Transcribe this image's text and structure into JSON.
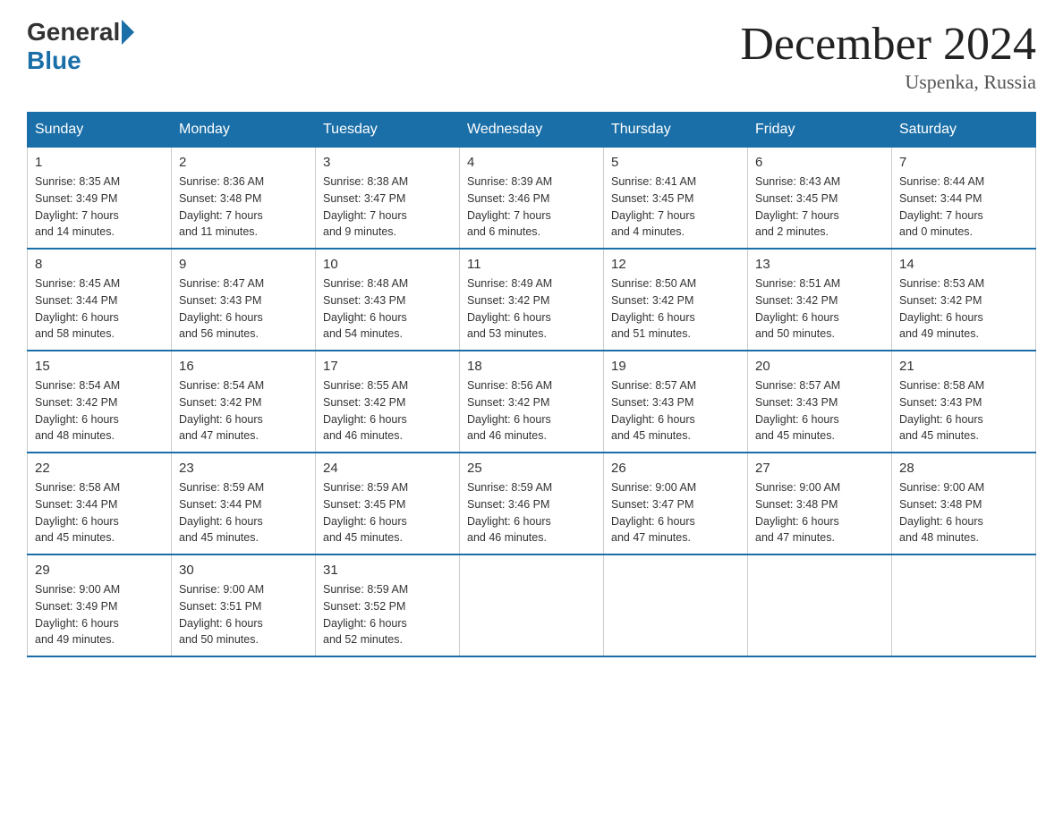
{
  "logo": {
    "general": "General",
    "blue": "Blue"
  },
  "header": {
    "title": "December 2024",
    "subtitle": "Uspenka, Russia"
  },
  "days_of_week": [
    "Sunday",
    "Monday",
    "Tuesday",
    "Wednesday",
    "Thursday",
    "Friday",
    "Saturday"
  ],
  "weeks": [
    [
      {
        "day": "1",
        "info": "Sunrise: 8:35 AM\nSunset: 3:49 PM\nDaylight: 7 hours\nand 14 minutes."
      },
      {
        "day": "2",
        "info": "Sunrise: 8:36 AM\nSunset: 3:48 PM\nDaylight: 7 hours\nand 11 minutes."
      },
      {
        "day": "3",
        "info": "Sunrise: 8:38 AM\nSunset: 3:47 PM\nDaylight: 7 hours\nand 9 minutes."
      },
      {
        "day": "4",
        "info": "Sunrise: 8:39 AM\nSunset: 3:46 PM\nDaylight: 7 hours\nand 6 minutes."
      },
      {
        "day": "5",
        "info": "Sunrise: 8:41 AM\nSunset: 3:45 PM\nDaylight: 7 hours\nand 4 minutes."
      },
      {
        "day": "6",
        "info": "Sunrise: 8:43 AM\nSunset: 3:45 PM\nDaylight: 7 hours\nand 2 minutes."
      },
      {
        "day": "7",
        "info": "Sunrise: 8:44 AM\nSunset: 3:44 PM\nDaylight: 7 hours\nand 0 minutes."
      }
    ],
    [
      {
        "day": "8",
        "info": "Sunrise: 8:45 AM\nSunset: 3:44 PM\nDaylight: 6 hours\nand 58 minutes."
      },
      {
        "day": "9",
        "info": "Sunrise: 8:47 AM\nSunset: 3:43 PM\nDaylight: 6 hours\nand 56 minutes."
      },
      {
        "day": "10",
        "info": "Sunrise: 8:48 AM\nSunset: 3:43 PM\nDaylight: 6 hours\nand 54 minutes."
      },
      {
        "day": "11",
        "info": "Sunrise: 8:49 AM\nSunset: 3:42 PM\nDaylight: 6 hours\nand 53 minutes."
      },
      {
        "day": "12",
        "info": "Sunrise: 8:50 AM\nSunset: 3:42 PM\nDaylight: 6 hours\nand 51 minutes."
      },
      {
        "day": "13",
        "info": "Sunrise: 8:51 AM\nSunset: 3:42 PM\nDaylight: 6 hours\nand 50 minutes."
      },
      {
        "day": "14",
        "info": "Sunrise: 8:53 AM\nSunset: 3:42 PM\nDaylight: 6 hours\nand 49 minutes."
      }
    ],
    [
      {
        "day": "15",
        "info": "Sunrise: 8:54 AM\nSunset: 3:42 PM\nDaylight: 6 hours\nand 48 minutes."
      },
      {
        "day": "16",
        "info": "Sunrise: 8:54 AM\nSunset: 3:42 PM\nDaylight: 6 hours\nand 47 minutes."
      },
      {
        "day": "17",
        "info": "Sunrise: 8:55 AM\nSunset: 3:42 PM\nDaylight: 6 hours\nand 46 minutes."
      },
      {
        "day": "18",
        "info": "Sunrise: 8:56 AM\nSunset: 3:42 PM\nDaylight: 6 hours\nand 46 minutes."
      },
      {
        "day": "19",
        "info": "Sunrise: 8:57 AM\nSunset: 3:43 PM\nDaylight: 6 hours\nand 45 minutes."
      },
      {
        "day": "20",
        "info": "Sunrise: 8:57 AM\nSunset: 3:43 PM\nDaylight: 6 hours\nand 45 minutes."
      },
      {
        "day": "21",
        "info": "Sunrise: 8:58 AM\nSunset: 3:43 PM\nDaylight: 6 hours\nand 45 minutes."
      }
    ],
    [
      {
        "day": "22",
        "info": "Sunrise: 8:58 AM\nSunset: 3:44 PM\nDaylight: 6 hours\nand 45 minutes."
      },
      {
        "day": "23",
        "info": "Sunrise: 8:59 AM\nSunset: 3:44 PM\nDaylight: 6 hours\nand 45 minutes."
      },
      {
        "day": "24",
        "info": "Sunrise: 8:59 AM\nSunset: 3:45 PM\nDaylight: 6 hours\nand 45 minutes."
      },
      {
        "day": "25",
        "info": "Sunrise: 8:59 AM\nSunset: 3:46 PM\nDaylight: 6 hours\nand 46 minutes."
      },
      {
        "day": "26",
        "info": "Sunrise: 9:00 AM\nSunset: 3:47 PM\nDaylight: 6 hours\nand 47 minutes."
      },
      {
        "day": "27",
        "info": "Sunrise: 9:00 AM\nSunset: 3:48 PM\nDaylight: 6 hours\nand 47 minutes."
      },
      {
        "day": "28",
        "info": "Sunrise: 9:00 AM\nSunset: 3:48 PM\nDaylight: 6 hours\nand 48 minutes."
      }
    ],
    [
      {
        "day": "29",
        "info": "Sunrise: 9:00 AM\nSunset: 3:49 PM\nDaylight: 6 hours\nand 49 minutes."
      },
      {
        "day": "30",
        "info": "Sunrise: 9:00 AM\nSunset: 3:51 PM\nDaylight: 6 hours\nand 50 minutes."
      },
      {
        "day": "31",
        "info": "Sunrise: 8:59 AM\nSunset: 3:52 PM\nDaylight: 6 hours\nand 52 minutes."
      },
      null,
      null,
      null,
      null
    ]
  ]
}
